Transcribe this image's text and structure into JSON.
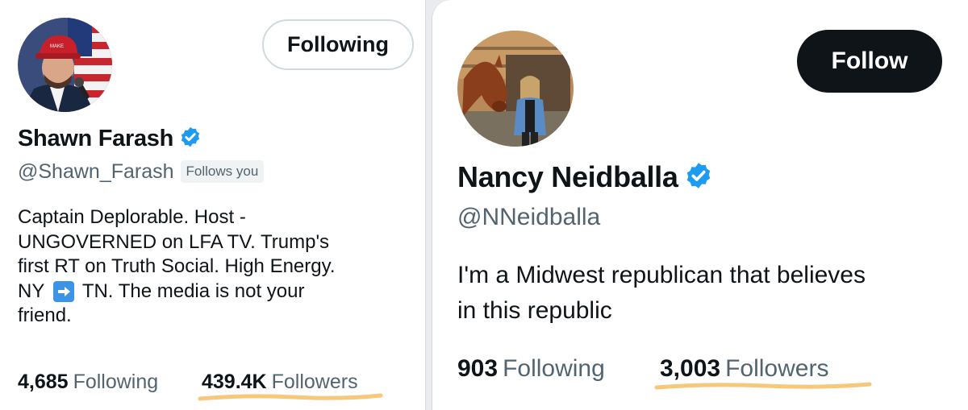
{
  "left_profile": {
    "action_button": "Following",
    "name": "Shawn Farash",
    "handle": "@Shawn_Farash",
    "follows_you_badge": "Follows you",
    "bio": {
      "line1": "Captain Deplorable. Host -",
      "line2": "UNGOVERNED on LFA TV.  Trump's",
      "line3": "first RT on Truth Social. High Energy.",
      "line4_before": "NY",
      "line4_after": "TN. The media is not your",
      "line5": "friend."
    },
    "following_count": "4,685",
    "following_label": "Following",
    "followers_count": "439.4K",
    "followers_label": "Followers",
    "avatar_icon": "avatar-photo",
    "verified_icon": "verified-badge-icon"
  },
  "right_profile": {
    "action_button": "Follow",
    "name": "Nancy Neidballa",
    "handle": "@NNeidballa",
    "bio": {
      "line1": "I'm a Midwest republican that believes",
      "line2": "in this republic"
    },
    "following_count": "903",
    "following_label": "Following",
    "followers_count": "3,003",
    "followers_label": "Followers",
    "avatar_icon": "avatar-photo",
    "verified_icon": "verified-badge-icon"
  },
  "colors": {
    "verified_blue": "#1d9bf0",
    "highlight_underline": "#f7c87a",
    "secondary_text": "#536471",
    "follow_button": "#0f1419"
  }
}
